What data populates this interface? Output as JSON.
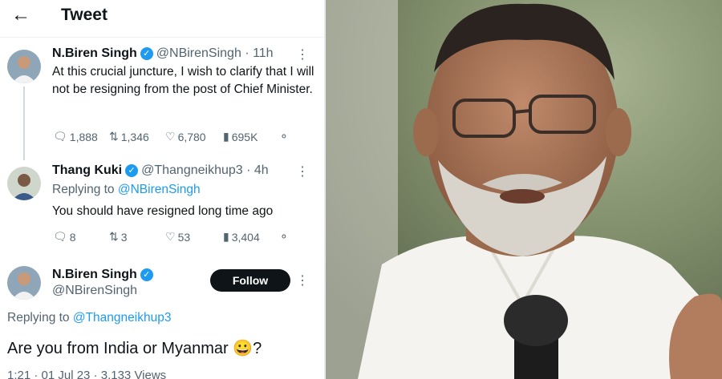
{
  "header": {
    "title": "Tweet"
  },
  "tweet1": {
    "name": "N.Biren Singh",
    "handle": "@NBirenSingh · 11h",
    "text": "At this crucial juncture, I wish to clarify that I will not be resigning from the post of Chief Minister.",
    "replies": "1,888",
    "retweets": "1,346",
    "likes": "6,780",
    "views": "695K"
  },
  "tweet2": {
    "name": "Thang Kuki",
    "handle": "@Thangneikhup3 · 4h",
    "replying_prefix": "Replying to",
    "replying_to": "@NBirenSingh",
    "text": "You should have resigned long time ago",
    "replies": "8",
    "retweets": "3",
    "likes": "53",
    "views": "3,404"
  },
  "tweet3": {
    "name": "N.Biren Singh",
    "handle": "@NBirenSingh",
    "follow_label": "Follow",
    "replying_prefix": "Replying to",
    "replying_to": "@Thangneikhup3",
    "text": "Are you from India or Myanmar 😀?",
    "meta": "1:21 · 01 Jul 23 · 3,133 Views"
  },
  "icons": {
    "back": "arrow-left-icon",
    "verified": "verified-badge-icon",
    "more": "more-dots-icon",
    "reply": "reply-icon",
    "retweet": "retweet-icon",
    "like": "heart-icon",
    "views": "views-icon",
    "share": "share-icon"
  },
  "colors": {
    "accent": "#1d9bf0",
    "text": "#0f1419",
    "muted": "#536471",
    "button": "#0f1419"
  }
}
